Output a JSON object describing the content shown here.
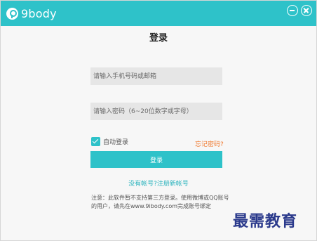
{
  "app": {
    "brand": "9body",
    "accent_color": "#2ec2c9"
  },
  "titlebar": {
    "minimize_icon": "minimize-icon",
    "close_icon": "close-icon"
  },
  "login": {
    "title": "登录",
    "phone_placeholder": "请输入手机号码或邮箱",
    "password_placeholder": "请输入密码（6~20位数字或字母）",
    "remember_label": "自动登录",
    "remember_checked": true,
    "forgot_label": "忘记密码?",
    "submit_label": "登录",
    "register_label": "没有帐号?注册新帐号",
    "notice": "注意：此软件暂不支持第三方登录。使用微博或QQ账号的用户，请先在www.9ibody.com完成账号绑定"
  },
  "watermark": {
    "text": "最需教育"
  }
}
